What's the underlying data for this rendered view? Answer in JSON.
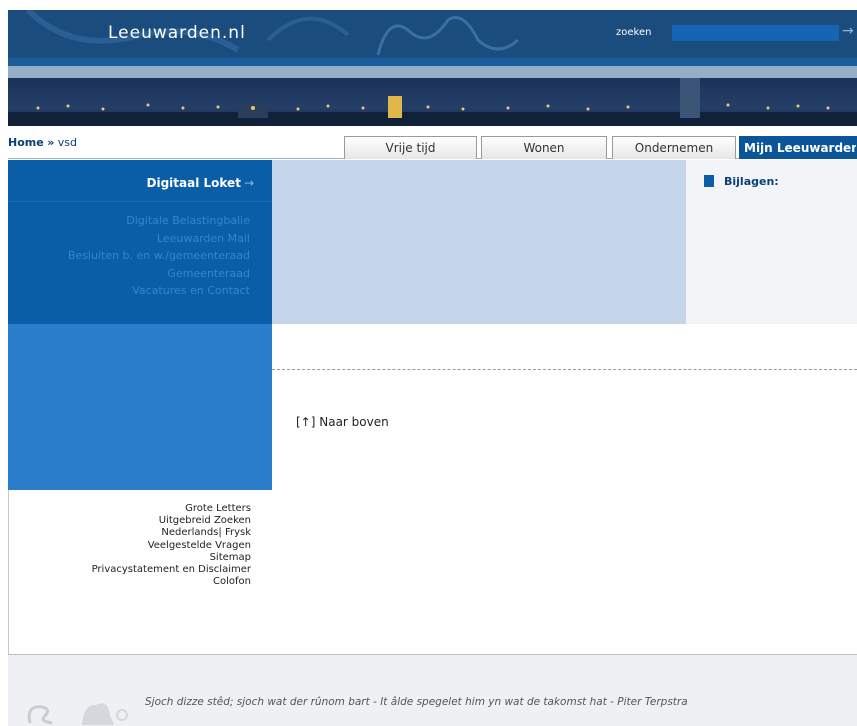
{
  "header": {
    "logo": "Leeuwarden.nl",
    "search_label": "zoeken",
    "search_arrow": "→"
  },
  "breadcrumb": {
    "home": "Home",
    "separator": "»",
    "current": "vsd"
  },
  "tabs": [
    {
      "label": "Vrije tijd"
    },
    {
      "label": "Wonen"
    },
    {
      "label": "Ondernemen"
    },
    {
      "label": "Mijn Leeuwarden",
      "active": true
    }
  ],
  "sidebar": {
    "title": "Digitaal Loket",
    "title_arrow": "→",
    "links": [
      {
        "label": "Digitale Belastingbalie"
      },
      {
        "label": "Leeuwarden Mail"
      },
      {
        "label": "Besluiten b. en w./gemeenteraad"
      },
      {
        "label": "Gemeenteraad"
      },
      {
        "label": "Vacatures en Contact"
      }
    ]
  },
  "utility_links": [
    {
      "label": "Grote Letters"
    },
    {
      "label": "Uitgebreid Zoeken"
    },
    {
      "label": "Nederlands| Frysk"
    },
    {
      "label": "Veelgestelde Vragen"
    },
    {
      "label": "Sitemap"
    },
    {
      "label": "Privacystatement en Disclaimer"
    },
    {
      "label": "Colofon"
    }
  ],
  "bijlagen": {
    "title": "Bijlagen:"
  },
  "main": {
    "to_top": "[↑] Naar boven"
  },
  "footer": {
    "quote": "Sjoch dizze stêd; sjoch wat der rûnom bart - It âlde spegelet him yn wat de takomst hat - Piter Terpstra"
  },
  "colors": {
    "header_bg": "#1a4c7e",
    "sidebar_bg": "#0a5ea8",
    "sidebar_link": "#2f87cf",
    "active_tab": "#0a5499",
    "main_top_bg": "#c5d6ea"
  }
}
